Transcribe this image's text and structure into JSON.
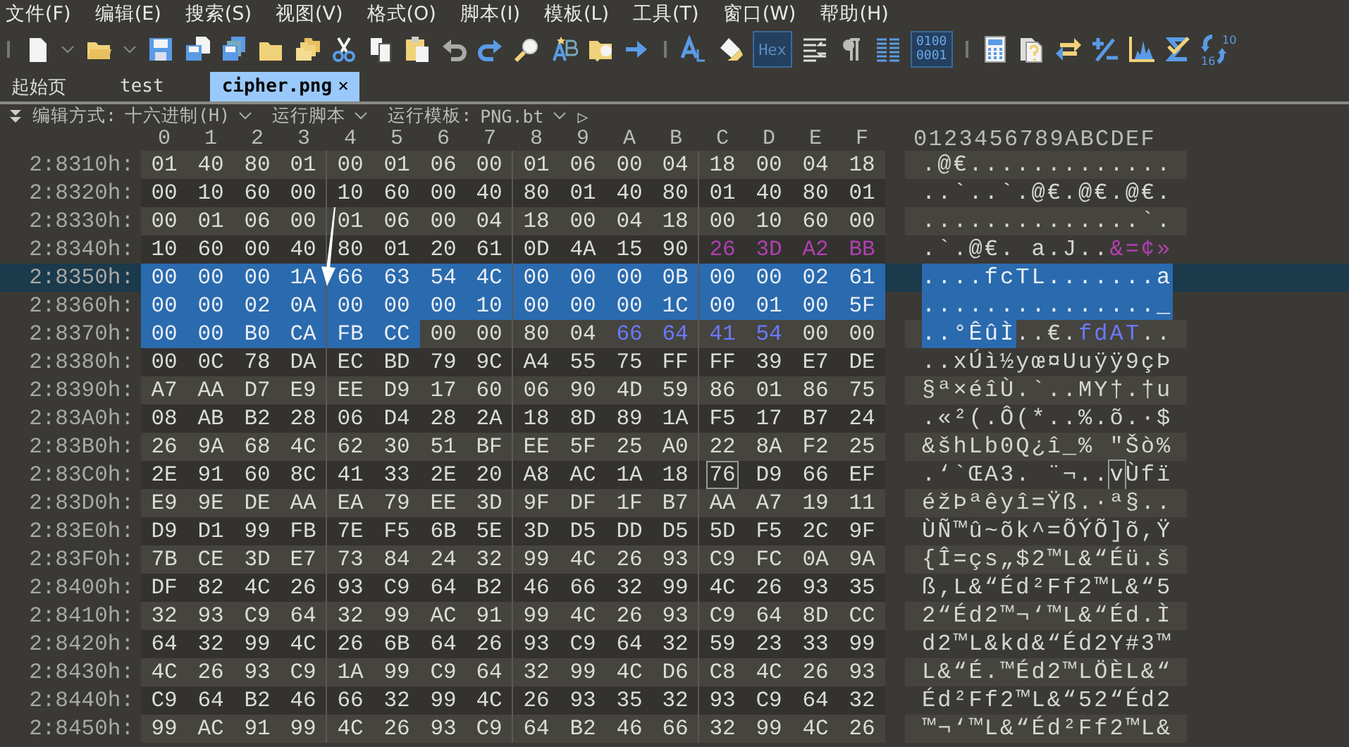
{
  "menu": [
    "文件(F)",
    "编辑(E)",
    "搜索(S)",
    "视图(V)",
    "格式(O)",
    "脚本(I)",
    "模板(L)",
    "工具(T)",
    "窗口(W)",
    "帮助(H)"
  ],
  "toolbar": {
    "hex_toggle": {
      "label": "Hex",
      "selected": true
    },
    "binary_toggle": {
      "lines": [
        "0100",
        "0001"
      ],
      "selected": true
    },
    "base_convert": {
      "labels": [
        "10",
        "16"
      ]
    }
  },
  "tabs": [
    {
      "label": "起始页",
      "selected": false
    },
    {
      "label": "test",
      "selected": false
    },
    {
      "label": "cipher.png",
      "selected": true,
      "close": "×"
    }
  ],
  "edit_bar": {
    "mode_label": "编辑方式:",
    "mode_value": "十六进制(H)",
    "run_script": "运行脚本",
    "template_label": "运行模板:",
    "template_value": "PNG.bt",
    "run": "▷"
  },
  "columns": [
    "0",
    "1",
    "2",
    "3",
    "4",
    "5",
    "6",
    "7",
    "8",
    "9",
    "A",
    "B",
    "C",
    "D",
    "E",
    "F"
  ],
  "ascii_header": "0123456789ABCDEF",
  "rows": [
    {
      "address": "2:8310h:",
      "current": false,
      "hex": [
        {
          "kind": "plain",
          "bytes": "01 40 80 01 00 01 06 00 01 06 00 04 18 00 04 18"
        }
      ],
      "ascii": [
        {
          "kind": "plain",
          "text": ".@€............."
        }
      ]
    },
    {
      "address": "2:8320h:",
      "current": false,
      "hex": [
        {
          "kind": "plain",
          "bytes": "00 10 60 00 10 60 00 40 80 01 40 80 01 40 80 01"
        }
      ],
      "ascii": [
        {
          "kind": "plain",
          "text": "..`..`.@€.@€.@€."
        }
      ]
    },
    {
      "address": "2:8330h:",
      "current": false,
      "hex": [
        {
          "kind": "plain",
          "bytes": "00 01 06 00 01 06 00 04 18 00 04 18 00 10 60 00"
        }
      ],
      "ascii": [
        {
          "kind": "plain",
          "text": "..............`."
        }
      ]
    },
    {
      "address": "2:8340h:",
      "current": false,
      "hex": [
        {
          "kind": "plain",
          "bytes": "10 60 00 40 80 01 20 61 0D 4A 15 90"
        },
        {
          "kind": "purple",
          "bytes": "26 3D A2 BB"
        }
      ],
      "ascii": [
        {
          "kind": "plain",
          "text": ".`.@€. a.J.."
        },
        {
          "kind": "purple",
          "text": "&=¢»"
        }
      ]
    },
    {
      "address": "2:8350h:",
      "current": true,
      "hex": [
        {
          "kind": "selected",
          "bytes": "00 00 00 1A 66 63 54 4C 00 00 00 0B 00 00 02 61"
        }
      ],
      "ascii": [
        {
          "kind": "selected",
          "text": "....fcTL.......a"
        }
      ]
    },
    {
      "address": "2:8360h:",
      "current": false,
      "hex": [
        {
          "kind": "selected",
          "bytes": "00 00 02 0A 00 00 00 10 00 00 00 1C 00 01 00 5F"
        }
      ],
      "ascii": [
        {
          "kind": "selected",
          "text": "..............._"
        }
      ]
    },
    {
      "address": "2:8370h:",
      "current": false,
      "hex": [
        {
          "kind": "selected",
          "bytes": "00 00 B0 CA FB CC"
        },
        {
          "kind": "plain",
          "bytes": "00 00 80 04"
        },
        {
          "kind": "navy",
          "bytes": "66 64 41 54"
        },
        {
          "kind": "plain",
          "bytes": "00 00"
        }
      ],
      "ascii": [
        {
          "kind": "selected",
          "text": "..°ÊûÌ"
        },
        {
          "kind": "plain",
          "text": "..€."
        },
        {
          "kind": "navy",
          "text": "fdAT"
        },
        {
          "kind": "plain",
          "text": ".."
        }
      ]
    },
    {
      "address": "2:8380h:",
      "current": false,
      "hex": [
        {
          "kind": "plain",
          "bytes": "00 0C 78 DA EC BD 79 9C A4 55 75 FF FF 39 E7 DE"
        }
      ],
      "ascii": [
        {
          "kind": "plain",
          "text": "..xÚì½yœ¤Uuÿÿ9çÞ"
        }
      ]
    },
    {
      "address": "2:8390h:",
      "current": false,
      "hex": [
        {
          "kind": "plain",
          "bytes": "A7 AA D7 E9 EE D9 17 60 06 90 4D 59 86 01 86 75"
        }
      ],
      "ascii": [
        {
          "kind": "plain",
          "text": "§ª×éîÙ.`..MY†.†u"
        }
      ]
    },
    {
      "address": "2:83A0h:",
      "current": false,
      "hex": [
        {
          "kind": "plain",
          "bytes": "08 AB B2 28 06 D4 28 2A 18 8D 89 1A F5 17 B7 24"
        }
      ],
      "ascii": [
        {
          "kind": "plain",
          "text": ".«²(.Ô(*..%.õ.·$"
        }
      ]
    },
    {
      "address": "2:83B0h:",
      "current": false,
      "hex": [
        {
          "kind": "plain",
          "bytes": "26 9A 68 4C 62 30 51 BF EE 5F 25 A0 22 8A F2 25"
        }
      ],
      "ascii": [
        {
          "kind": "plain",
          "text": "&šhLb0Q¿î_% \"Šò%"
        }
      ]
    },
    {
      "address": "2:83C0h:",
      "current": false,
      "hex": [
        {
          "kind": "plain",
          "bytes": "2E 91 60 8C 41 33 2E 20 A8 AC 1A 18"
        },
        {
          "kind": "cursor",
          "bytes": "76"
        },
        {
          "kind": "plain",
          "bytes": "D9 66 EF"
        }
      ],
      "ascii": [
        {
          "kind": "plain",
          "text": ".‘`ŒA3. ¨¬.."
        },
        {
          "kind": "cursor",
          "text": "v"
        },
        {
          "kind": "plain",
          "text": "Ùfï"
        }
      ]
    },
    {
      "address": "2:83D0h:",
      "current": false,
      "hex": [
        {
          "kind": "plain",
          "bytes": "E9 9E DE AA EA 79 EE 3D 9F DF 1F B7 AA A7 19 11"
        }
      ],
      "ascii": [
        {
          "kind": "plain",
          "text": "éžÞªêyî=Ÿß.·ª§.."
        }
      ]
    },
    {
      "address": "2:83E0h:",
      "current": false,
      "hex": [
        {
          "kind": "plain",
          "bytes": "D9 D1 99 FB 7E F5 6B 5E 3D D5 DD D5 5D F5 2C 9F"
        }
      ],
      "ascii": [
        {
          "kind": "plain",
          "text": "ÙÑ™û~õk^=ÕÝÕ]õ,Ÿ"
        }
      ]
    },
    {
      "address": "2:83F0h:",
      "current": false,
      "hex": [
        {
          "kind": "plain",
          "bytes": "7B CE 3D E7 73 84 24 32 99 4C 26 93 C9 FC 0A 9A"
        }
      ],
      "ascii": [
        {
          "kind": "plain",
          "text": "{Î=çs„$2™L&“Éü.š"
        }
      ]
    },
    {
      "address": "2:8400h:",
      "current": false,
      "hex": [
        {
          "kind": "plain",
          "bytes": "DF 82 4C 26 93 C9 64 B2 46 66 32 99 4C 26 93 35"
        }
      ],
      "ascii": [
        {
          "kind": "plain",
          "text": "ß‚L&“Éd²Ff2™L&“5"
        }
      ]
    },
    {
      "address": "2:8410h:",
      "current": false,
      "hex": [
        {
          "kind": "plain",
          "bytes": "32 93 C9 64 32 99 AC 91 99 4C 26 93 C9 64 8D CC"
        }
      ],
      "ascii": [
        {
          "kind": "plain",
          "text": "2“Éd2™¬‘™L&“Éd.Ì"
        }
      ]
    },
    {
      "address": "2:8420h:",
      "current": false,
      "hex": [
        {
          "kind": "plain",
          "bytes": "64 32 99 4C 26 6B 64 26 93 C9 64 32 59 23 33 99"
        }
      ],
      "ascii": [
        {
          "kind": "plain",
          "text": "d2™L&kd&“Éd2Y#3™"
        }
      ]
    },
    {
      "address": "2:8430h:",
      "current": false,
      "hex": [
        {
          "kind": "plain",
          "bytes": "4C 26 93 C9 1A 99 C9 64 32 99 4C D6 C8 4C 26 93"
        }
      ],
      "ascii": [
        {
          "kind": "plain",
          "text": "L&“É.™Éd2™LÖÈL&“"
        }
      ]
    },
    {
      "address": "2:8440h:",
      "current": false,
      "hex": [
        {
          "kind": "plain",
          "bytes": "C9 64 B2 46 66 32 99 4C 26 93 35 32 93 C9 64 32"
        }
      ],
      "ascii": [
        {
          "kind": "plain",
          "text": "Éd²Ff2™L&“52“Éd2"
        }
      ]
    },
    {
      "address": "2:8450h:",
      "current": false,
      "hex": [
        {
          "kind": "plain",
          "bytes": "99 AC 91 99 4C 26 93 C9 64 B2 46 66 32 99 4C 26"
        }
      ],
      "ascii": [
        {
          "kind": "plain",
          "text": "™¬‘™L&“Éd²Ff2™L&"
        }
      ]
    }
  ]
}
